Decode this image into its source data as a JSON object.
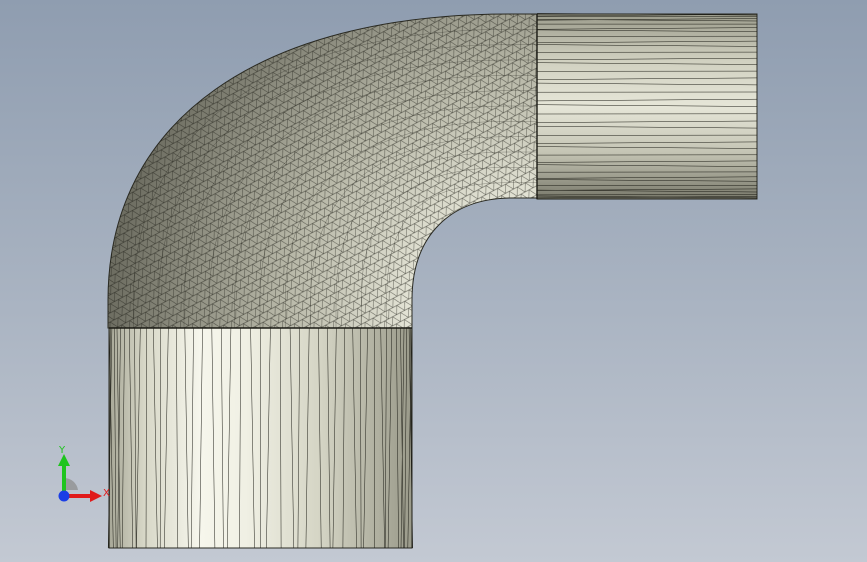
{
  "scene": {
    "model": "pipe-elbow-mesh",
    "background_top": "#8f9db0",
    "background_bottom": "#c3c9d3",
    "mesh_line_color": "#1b1b14",
    "surface_light": "#f2f2e6",
    "surface_mid": "#c9c9b8",
    "surface_dark": "#5c5c50"
  },
  "triad": {
    "x_label": "X",
    "y_label": "Y",
    "x_color": "#e01a1a",
    "y_color": "#1ec41e",
    "z_color": "#1a3ee6"
  }
}
